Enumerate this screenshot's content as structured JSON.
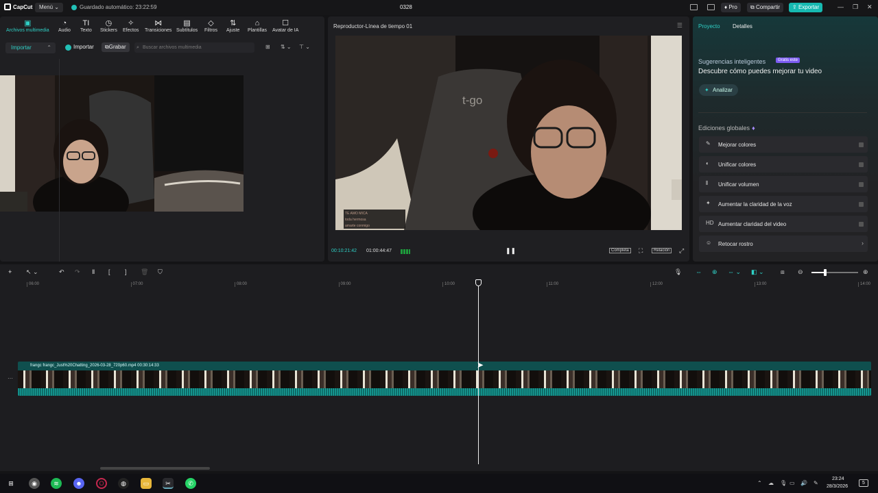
{
  "topbar": {
    "logo": "CapCut",
    "menu_label": "Menú ⌄",
    "autosave": "Guardado automático: 23:22:59",
    "project_title": "0328",
    "pro_label": "Pro",
    "share_label": "Compartir",
    "export_label": "Exportar"
  },
  "toolbar": {
    "items": [
      {
        "label": "Archivos multimedia",
        "icon": "▣"
      },
      {
        "label": "Audio",
        "icon": "◔"
      },
      {
        "label": "Texto",
        "icon": "TI"
      },
      {
        "label": "Stickers",
        "icon": "◷"
      },
      {
        "label": "Efectos",
        "icon": "✧"
      },
      {
        "label": "Transiciones",
        "icon": "⋈"
      },
      {
        "label": "Subtítulos",
        "icon": "▤"
      },
      {
        "label": "Filtros",
        "icon": "◇"
      },
      {
        "label": "Ajuste",
        "icon": "⇅"
      },
      {
        "label": "Plantillas",
        "icon": "⌂"
      },
      {
        "label": "Avatar de IA",
        "icon": "☐"
      }
    ]
  },
  "media": {
    "side_import": "Importar",
    "import_label": "Importar",
    "record_label": "Grabar",
    "search_placeholder": "Buscar archivos multimedia"
  },
  "player": {
    "title": "Reproductor-Línea de tiempo 01",
    "current_time": "00:10:21:42",
    "total_time": "01:00:44:47",
    "completa_label": "Completa",
    "relacion_label": "Relación",
    "chat_lines": [
      "TE AMO MICA",
      "toda hermosa",
      "amarte conmigo"
    ]
  },
  "right_panel": {
    "tab_project": "Proyecto",
    "tab_details": "Detalles",
    "suggestions_title": "Sugerencias inteligentes",
    "suggestions_badge": "Gratis este",
    "suggestions_desc": "Descubre cómo puedes mejorar tu video",
    "analyze_label": "Analizar",
    "global_title": "Ediciones globales",
    "edits": [
      {
        "label": "Mejorar colores",
        "icon": "✎"
      },
      {
        "label": "Unificar colores",
        "icon": "◐"
      },
      {
        "label": "Unificar volumen",
        "icon": "⫴"
      },
      {
        "label": "Aumentar la claridad de la voz",
        "icon": "✦"
      },
      {
        "label": "Aumentar claridad del video",
        "icon": "HD"
      },
      {
        "label": "Retocar rostro",
        "icon": "☺"
      }
    ]
  },
  "timeline": {
    "ticks": [
      "06:00",
      "07:00",
      "08:00",
      "09:00",
      "10:00",
      "11:00",
      "12:00",
      "13:00",
      "14:00"
    ],
    "clip_label": "frangc  frangc_Just%20Chatting_2026-03-28_720p60.mp4   00:30:14:33",
    "zoom_level": 0.29
  },
  "taskbar": {
    "time": "23:24",
    "date": "28/3/2026",
    "notifications": "5"
  }
}
